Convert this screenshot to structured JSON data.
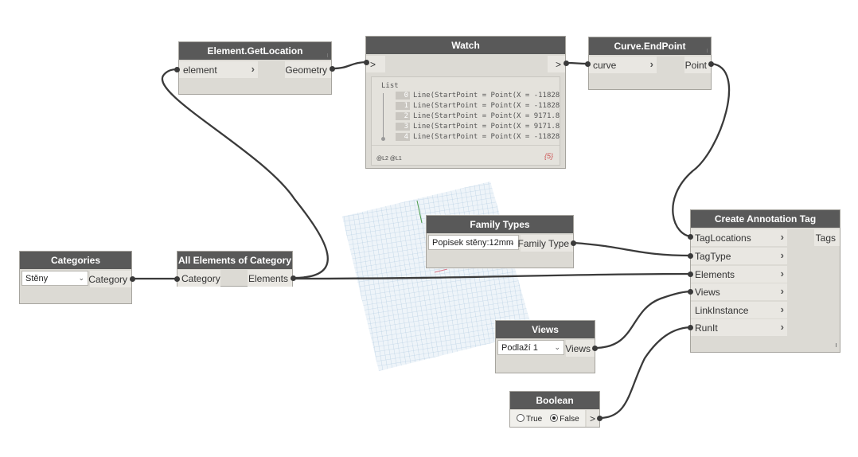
{
  "nodes": {
    "get_location": {
      "title": "Element.GetLocation",
      "input": "element",
      "output": "Geometry"
    },
    "watch": {
      "title": "Watch",
      "input_arrow": ">",
      "output_arrow": ">",
      "list_label": "List",
      "items": [
        {
          "index": "0",
          "text": "Line(StartPoint = Point(X = -11828"
        },
        {
          "index": "1",
          "text": "Line(StartPoint = Point(X = -11828"
        },
        {
          "index": "2",
          "text": "Line(StartPoint = Point(X = 9171.8"
        },
        {
          "index": "3",
          "text": "Line(StartPoint = Point(X = 9171.8"
        },
        {
          "index": "4",
          "text": "Line(StartPoint = Point(X = -11828"
        }
      ],
      "levels": "@L2 @L1",
      "count": "{5}"
    },
    "end_point": {
      "title": "Curve.EndPoint",
      "input": "curve",
      "output": "Point"
    },
    "categories": {
      "title": "Categories",
      "selected": "Stěny",
      "output": "Category"
    },
    "all_elements": {
      "title": "All Elements of Category",
      "input": "Category",
      "output": "Elements"
    },
    "family_types": {
      "title": "Family Types",
      "selected": "Popisek stěny:12mm",
      "output": "Family Type"
    },
    "create_tag": {
      "title": "Create Annotation Tag",
      "inputs": [
        "TagLocations",
        "TagType",
        "Elements",
        "Views",
        "LinkInstance",
        "RunIt"
      ],
      "output": "Tags"
    },
    "views": {
      "title": "Views",
      "selected": "Podlaží 1",
      "output": "Views"
    },
    "boolean": {
      "title": "Boolean",
      "true_label": "True",
      "false_label": "False",
      "selected": "False",
      "output_arrow": ">"
    }
  },
  "colors": {
    "header": "#595959",
    "node_body": "#dcdad4",
    "wire": "#3a3a3a",
    "grid_fill": "#e9f1f7",
    "grid_line": "#a9c6dd"
  }
}
